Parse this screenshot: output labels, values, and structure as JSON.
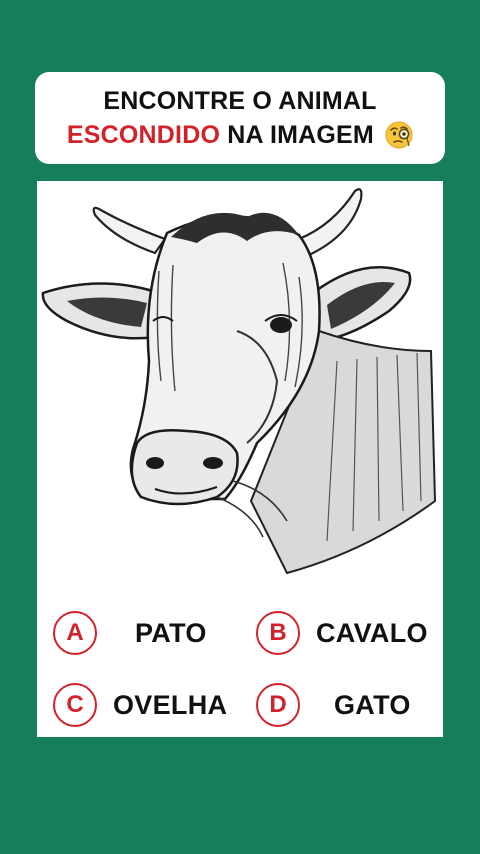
{
  "header": {
    "line1": "ENCONTRE O ANIMAL",
    "line2_highlight": "ESCONDIDO",
    "line2_rest": " NA IMAGEM",
    "emoji_icon": "face-with-monocle-icon"
  },
  "colors": {
    "background": "#177e5a",
    "accent": "#d2232a",
    "text": "#111111"
  },
  "illustration": {
    "subject_icon": "cow-head-sketch-icon"
  },
  "options": [
    {
      "letter": "A",
      "label": "PATO"
    },
    {
      "letter": "B",
      "label": "CAVALO"
    },
    {
      "letter": "C",
      "label": "OVELHA"
    },
    {
      "letter": "D",
      "label": "GATO"
    }
  ]
}
